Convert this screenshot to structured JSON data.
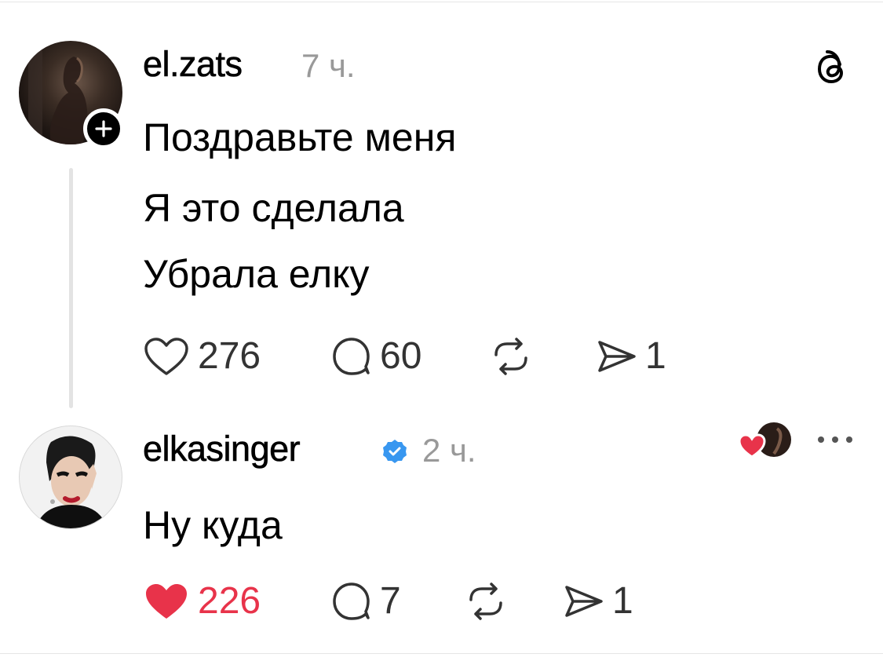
{
  "colors": {
    "text": "#000000",
    "muted": "#999999",
    "like_active": "#e8334a",
    "verified": "#3897f0",
    "thread_line": "#e3e3e3"
  },
  "post": {
    "username": "el.zats",
    "time": "7 ч.",
    "lines": [
      "Поздравьте меня",
      "Я это сделала",
      "Убрала елку"
    ],
    "actions": {
      "likes": "276",
      "replies": "60",
      "reposts": "",
      "shares": "1"
    },
    "icons": [
      "threads-logo-icon",
      "follow-plus-icon",
      "heart-outline-icon",
      "comment-icon",
      "repost-icon",
      "send-icon"
    ]
  },
  "reply": {
    "username": "elkasinger",
    "verified": true,
    "time": "2 ч.",
    "text": "Ну куда",
    "author_liked": true,
    "actions": {
      "likes": "226",
      "liked": true,
      "replies": "7",
      "reposts": "",
      "shares": "1"
    },
    "icons": [
      "verified-badge-icon",
      "heart-filled-icon",
      "more-icon",
      "comment-icon",
      "repost-icon",
      "send-icon"
    ]
  }
}
